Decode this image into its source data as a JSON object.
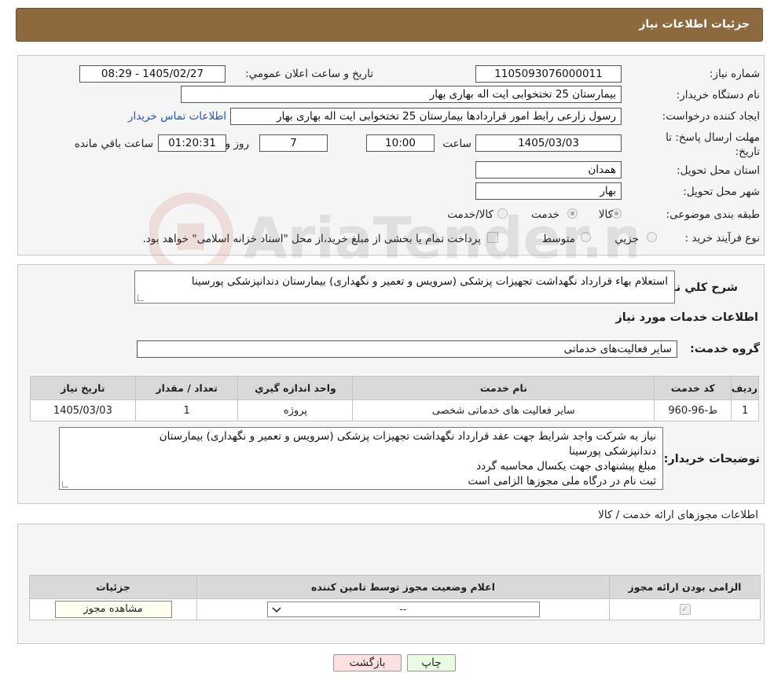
{
  "header": {
    "title": "جزئیات اطلاعات نیاز"
  },
  "form": {
    "need_number_label": "شماره نیاز:",
    "need_number": "1105093076000011",
    "announce_label": "تاریخ و ساعت اعلان عمومي:",
    "announce_value": "1405/02/27 - 08:29",
    "buyer_org_label": "نام دستگاه خريدار:",
    "buyer_org": "بیمارستان 25 تختخوابی ایت اله بهاری بهار",
    "requester_label": "ايجاد کننده درخواست:",
    "requester": "رسول زارعی رابط امور قراردادها بیمارستان 25 تختخوابی ایت اله بهاری بهار",
    "contact_link": "اطلاعات تماس خريدار",
    "deadline_label": "مهلت ارسال پاسخ: تا تاريخ:",
    "deadline_date": "1405/03/03",
    "time_label": "ساعت",
    "deadline_time": "10:00",
    "days_value": "7",
    "days_label": "روز و",
    "remaining_time": "01:20:31",
    "remaining_label": "ساعت باقي مانده",
    "province_label": "استان محل تحويل:",
    "province": "همدان",
    "city_label": "شهر محل تحويل:",
    "city": "بهار",
    "category_label": "طبقه بندی موضوعی:",
    "category_options": [
      "کالا",
      "خدمت",
      "کالا/خدمت"
    ],
    "purchase_type_label": "نوع فرآيند خريد :",
    "purchase_options": [
      "جزيي",
      "متوسط"
    ],
    "purchase_note": "پرداخت تمام یا بخشی از مبلغ خرید،از محل \"اسناد خزانه اسلامی\" خواهد بود."
  },
  "summary": {
    "label": "شرح کلي نياز:",
    "text": "استعلام بهاء قرارداد نگهداشت تجهیزات پزشکی (سرویس و تعمیر و نگهداری) بیمارستان دندانپزشکی پورسینا",
    "services_title": "اطلاعات خدمات مورد نياز",
    "service_group_label": "گروه خدمت:",
    "service_group": "ساير فعاليت‌های خدماتی"
  },
  "services_table": {
    "headers": [
      "رديف",
      "کد خدمت",
      "نام خدمت",
      "واحد اندازه گيري",
      "تعداد / مقدار",
      "تاريخ نياز"
    ],
    "rows": [
      [
        "1",
        "ط-96-960",
        "ساير فعاليت های خدماتی شخصی",
        "پروژه",
        "1",
        "1405/03/03"
      ]
    ]
  },
  "buyer_notes": {
    "label": "توضيحات خريدار:",
    "lines": [
      "نیاز به شرکت واجد شرایط جهت عقد قرارداد نگهداشت تجهیزات پزشکی (سرویس و تعمیر و نگهداری) بیمارستان",
      "دندانپزشکی پورسینا",
      "مبلغ پیشنهادی جهت یکسال محاسبه گردد",
      "ثبت نام در درگاه ملی مجوزها الزامی است"
    ]
  },
  "permits": {
    "title": "اطلاعات مجوزهای ارائه خدمت / کالا",
    "headers": [
      "الزامی بودن ارائه مجوز",
      "اعلام وضعیت مجوز توسط تامین کننده",
      "جزئیات"
    ],
    "select_value": "--",
    "view_button": "مشاهده مجوز"
  },
  "buttons": {
    "print": "چاپ",
    "back": "بازگشت"
  },
  "watermark": {
    "text": "AriaTender.neT"
  },
  "colors": {
    "header_bg": "#8c6a3d",
    "link": "#1f56c7",
    "back_btn_bg": "#fde0e0",
    "print_btn_bg": "#e9fbe0"
  }
}
